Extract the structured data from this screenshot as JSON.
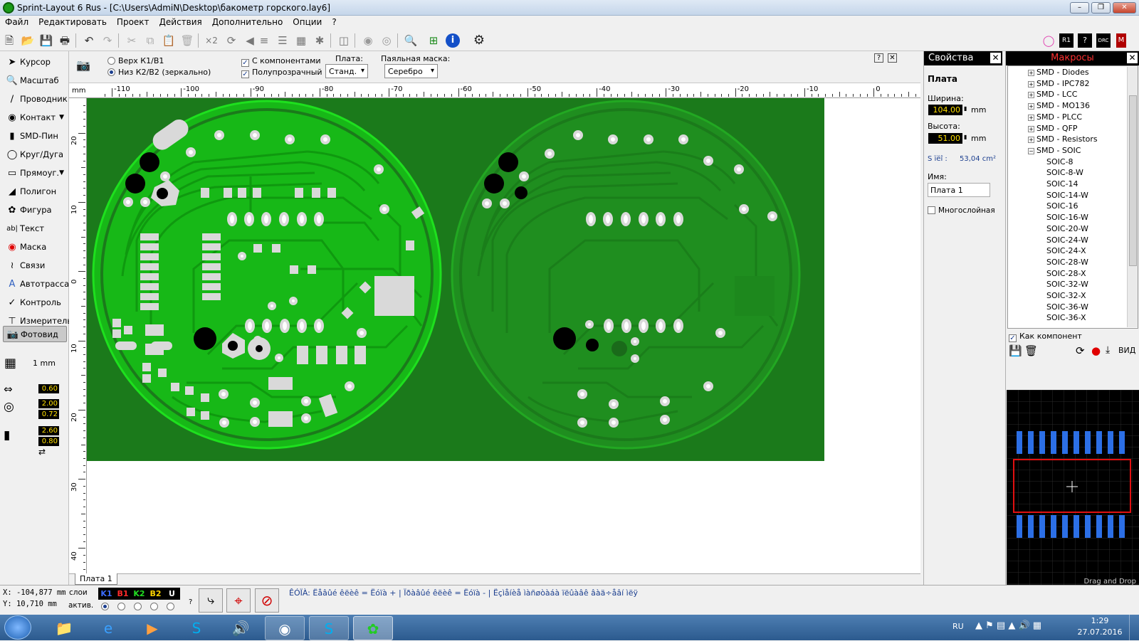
{
  "window": {
    "title": "Sprint-Layout 6 Rus - [C:\\Users\\AdmiN\\Desktop\\бакометр горского.lay6]"
  },
  "menu": [
    "Файл",
    "Редактировать",
    "Проект",
    "Действия",
    "Дополнительно",
    "Опции",
    "?"
  ],
  "toolbar": {
    "multiply_label": "×2"
  },
  "tools": [
    "Курсор",
    "Масштаб",
    "Проводник",
    "Контакт",
    "SMD-Пин",
    "Круг/Дуга",
    "Прямоуг.",
    "Полигон",
    "Фигура",
    "Текст",
    "Маска",
    "Связи",
    "Автотрасса",
    "Контроль",
    "Измеритель",
    "Фотовид"
  ],
  "grid": {
    "label": "1 mm"
  },
  "track_values": {
    "width": "0.60",
    "pad_outer": "2.00",
    "pad_inner": "0.72",
    "smd_w": "2.60",
    "smd_h": "0.80"
  },
  "options": {
    "side_top": "Верх К1/В1",
    "side_bottom": "Низ К2/В2 (зеркально)",
    "with_components": "С компонентами",
    "semi_transparent": "Полупрозрачный",
    "board_label": "Плата:",
    "board_value": "Станд.",
    "mask_label": "Паяльная маска:",
    "mask_value": "Серебро"
  },
  "ruler": {
    "unit": "mm",
    "top_labels": [
      "-110",
      "-100",
      "-90",
      "-80",
      "-70",
      "-60",
      "-50",
      "-40",
      "-30",
      "-20",
      "-10",
      "0"
    ],
    "left_labels": [
      "20",
      "10",
      "0",
      "10",
      "20",
      "30",
      "40"
    ]
  },
  "tab": {
    "label": "Плата 1"
  },
  "properties": {
    "title": "Свойства",
    "section": "Плата",
    "width_label": "Ширина:",
    "width_value": "104.00",
    "height_label": "Высота:",
    "height_value": "51.00",
    "unit": "mm",
    "area_label": "S ïëî :",
    "area_value": "53,04 cm²",
    "name_label": "Имя:",
    "name_value": "Плата 1",
    "multilayer": "Многослойная"
  },
  "macros": {
    "title": "Макросы",
    "tree": [
      {
        "label": "SMD - Diodes",
        "type": "folder"
      },
      {
        "label": "SMD - IPC782",
        "type": "folder"
      },
      {
        "label": "SMD - LCC",
        "type": "folder"
      },
      {
        "label": "SMD - MO136",
        "type": "folder"
      },
      {
        "label": "SMD - PLCC",
        "type": "folder"
      },
      {
        "label": "SMD - QFP",
        "type": "folder"
      },
      {
        "label": "SMD - Resistors",
        "type": "folder"
      },
      {
        "label": "SMD - SOIC",
        "type": "open"
      },
      {
        "label": "SOIC-8",
        "type": "leaf"
      },
      {
        "label": "SOIC-8-W",
        "type": "leaf"
      },
      {
        "label": "SOIC-14",
        "type": "leaf"
      },
      {
        "label": "SOIC-14-W",
        "type": "leaf"
      },
      {
        "label": "SOIC-16",
        "type": "leaf"
      },
      {
        "label": "SOIC-16-W",
        "type": "leaf"
      },
      {
        "label": "SOIC-20-W",
        "type": "leaf"
      },
      {
        "label": "SOIC-24-W",
        "type": "leaf"
      },
      {
        "label": "SOIC-24-X",
        "type": "leaf"
      },
      {
        "label": "SOIC-28-W",
        "type": "leaf"
      },
      {
        "label": "SOIC-28-X",
        "type": "leaf"
      },
      {
        "label": "SOIC-32-W",
        "type": "leaf"
      },
      {
        "label": "SOIC-32-X",
        "type": "leaf"
      },
      {
        "label": "SOIC-36-W",
        "type": "leaf"
      },
      {
        "label": "SOIC-36-X",
        "type": "leaf"
      }
    ],
    "as_component": "Как компонент",
    "view_label": "ВИД",
    "drag_drop": "Drag and Drop"
  },
  "status": {
    "x": "X: -104,877 mm",
    "y": "Y:   10,710 mm",
    "layers_label": "слои",
    "active_label": "актив.",
    "layers": [
      {
        "name": "K1",
        "color": "#3b6cff"
      },
      {
        "name": "B1",
        "color": "#ff2a2a"
      },
      {
        "name": "K2",
        "color": "#22dd22"
      },
      {
        "name": "B2",
        "color": "#ffd400"
      },
      {
        "name": "U",
        "color": "#ffffff"
      }
    ],
    "help": "?",
    "hint": "ÊÓÏÀ:  Ëåâûé êëèê = Ëóïà + | Ïðàâûé êëèê = Ëóïà - | Ëçìåíèå ìàñøòàáà ïëûàâê âàä÷åâí ìëÿ"
  },
  "taskbar": {
    "lang": "RU",
    "time": "1:29",
    "date": "27.07.2016"
  },
  "colors": {
    "board": "#1b7a1b",
    "copper_top": "#19c119",
    "copper_bottom": "#1f8e1f",
    "pad": "#d9d9d9",
    "menu_accent": "#1c3f8f"
  }
}
